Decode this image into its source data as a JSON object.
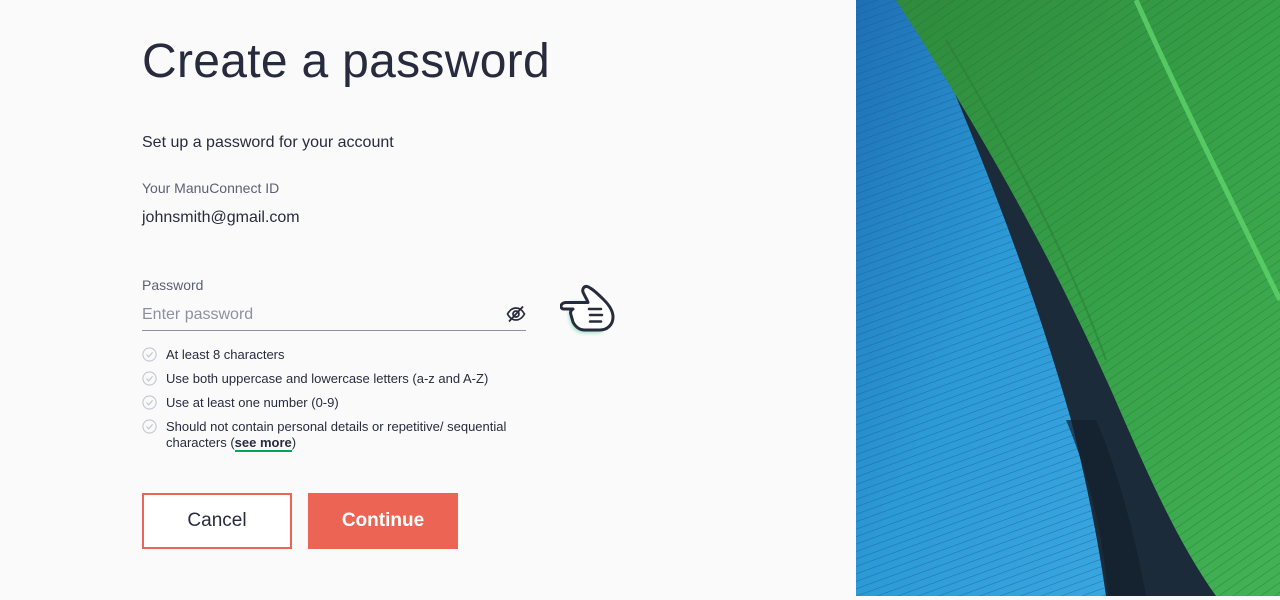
{
  "page": {
    "title": "Create a password",
    "subtitle": "Set up a password for your account"
  },
  "account": {
    "id_label": "Your ManuConnect ID",
    "id_value": "johnsmith@gmail.com"
  },
  "password": {
    "label": "Password",
    "placeholder": "Enter password",
    "value": "",
    "visibility_icon": "eye-slash-icon"
  },
  "rules": [
    {
      "text": "At least 8 characters",
      "met": false
    },
    {
      "text": "Use both uppercase and lowercase letters (a-z and A-Z)",
      "met": false
    },
    {
      "text": "Use at least one number (0-9)",
      "met": false
    },
    {
      "text": "Should not contain personal details or repetitive/ sequential characters",
      "met": false
    }
  ],
  "see_more": {
    "prefix": "(",
    "link": "see more",
    "suffix": ")"
  },
  "buttons": {
    "cancel": "Cancel",
    "continue": "Continue"
  },
  "hero": {
    "image": "blue and green feathers photograph"
  },
  "colors": {
    "accent": "#ec6453",
    "link_underline": "#00a758",
    "text": "#282b3e",
    "muted": "#5e6073"
  }
}
